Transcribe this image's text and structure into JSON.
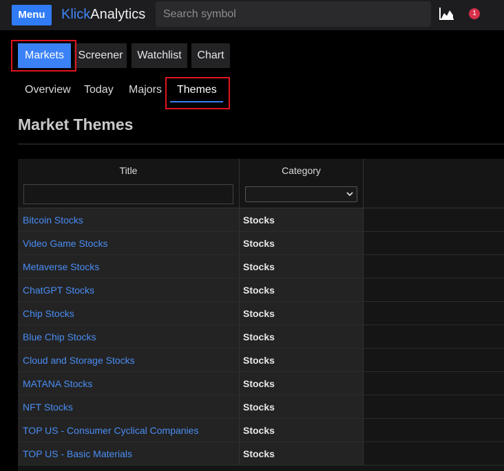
{
  "header": {
    "menu_label": "Menu",
    "brand_part1": "Klick",
    "brand_part2": "Analytics",
    "search_placeholder": "Search symbol",
    "notification_count": "1"
  },
  "main_tabs": [
    "Markets",
    "Screener",
    "Watchlist",
    "Chart"
  ],
  "sub_tabs": [
    "Overview",
    "Today",
    "Majors",
    "Themes"
  ],
  "page_title": "Market Themes",
  "table": {
    "columns": [
      "Title",
      "Category"
    ],
    "rows": [
      {
        "title": "Bitcoin Stocks",
        "category": "Stocks"
      },
      {
        "title": "Video Game Stocks",
        "category": "Stocks"
      },
      {
        "title": "Metaverse Stocks",
        "category": "Stocks"
      },
      {
        "title": "ChatGPT Stocks",
        "category": "Stocks"
      },
      {
        "title": "Chip Stocks",
        "category": "Stocks"
      },
      {
        "title": "Blue Chip Stocks",
        "category": "Stocks"
      },
      {
        "title": "Cloud and Storage Stocks",
        "category": "Stocks"
      },
      {
        "title": "MATANA Stocks",
        "category": "Stocks"
      },
      {
        "title": "NFT Stocks",
        "category": "Stocks"
      },
      {
        "title": "TOP US - Consumer Cyclical Companies",
        "category": "Stocks"
      },
      {
        "title": "TOP US - Basic Materials",
        "category": "Stocks"
      }
    ]
  },
  "colors": {
    "accent": "#3b82f6",
    "highlight_box": "#e0141e",
    "link": "#4a8df4",
    "badge": "#d6304a"
  },
  "icons": [
    "chart-area-icon",
    "notification-badge",
    "chevron-down-icon"
  ]
}
